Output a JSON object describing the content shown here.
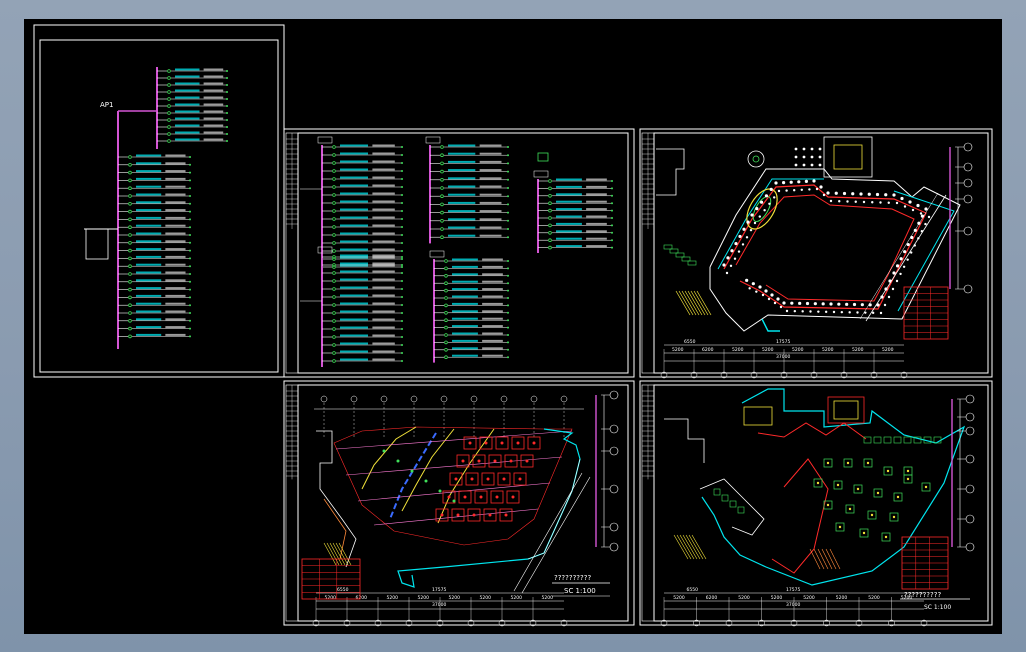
{
  "viewer": {
    "background_color": "#8c9db2",
    "canvas_color": "#000000"
  },
  "sheet1": {
    "panel_label": "AP1"
  },
  "sheet4": {
    "dims_top": [
      "6550",
      "17575"
    ],
    "dims_bottom": [
      "5200",
      "6200",
      "5200",
      "5200",
      "5200",
      "5200",
      "5200",
      "5200"
    ],
    "total": "37000",
    "title": "??????????",
    "scale": "SC 1:100"
  },
  "sheet5": {
    "dims_top": [
      "6550",
      "17575"
    ],
    "dims_bottom": [
      "5200",
      "6200",
      "5200",
      "5200",
      "5200",
      "5200",
      "5200",
      "5200"
    ],
    "total": "37000",
    "title": "??????????",
    "scale": "SC 1:100"
  },
  "colors": {
    "frame": "#ffffff",
    "bus": "#d455d4",
    "green": "#3fe05a",
    "cyan": "#00e5ee",
    "red": "#ff2a2a",
    "yellow": "#f2e23a",
    "orange": "#ff8a3a"
  }
}
